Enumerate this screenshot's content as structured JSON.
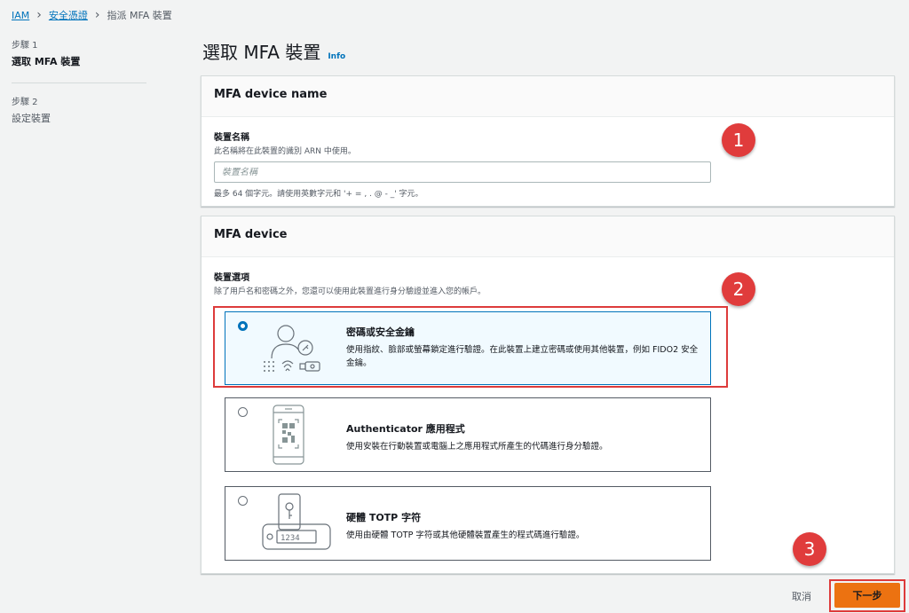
{
  "breadcrumb": {
    "items": [
      "IAM",
      "安全憑證"
    ],
    "current": "指派 MFA 裝置"
  },
  "steps": [
    {
      "label": "步驟 1",
      "title": "選取 MFA 裝置"
    },
    {
      "label": "步驟 2",
      "title": "設定裝置"
    }
  ],
  "page": {
    "title": "選取 MFA 裝置",
    "info": "Info"
  },
  "name_panel": {
    "header": "MFA device name",
    "label": "裝置名稱",
    "description": "此名稱將在此裝置的識別 ARN 中使用。",
    "placeholder": "裝置名稱",
    "constraint": "最多 64 個字元。請使用英數字元和 '+ = , . @ - _' 字元。"
  },
  "device_panel": {
    "header": "MFA device",
    "label": "裝置選項",
    "description": "除了用戶名和密碼之外，您還可以使用此裝置進行身分驗證並進入您的帳戶。",
    "options": [
      {
        "title": "密碼或安全金鑰",
        "description": "使用指紋、臉部或螢幕鎖定進行驗證。在此裝置上建立密碼或使用其他裝置，例如 FIDO2 安全金鑰。",
        "selected": true,
        "icon": "passkey-icon"
      },
      {
        "title": "Authenticator 應用程式",
        "description": "使用安裝在行動裝置或電腦上之應用程式所產生的代碼進行身分驗證。",
        "selected": false,
        "icon": "authenticator-app-icon"
      },
      {
        "title": "硬體 TOTP 字符",
        "description": "使用由硬體 TOTP 字符或其他硬體裝置產生的程式碼進行驗證。",
        "selected": false,
        "icon": "hardware-token-icon",
        "token_display": "1234"
      }
    ]
  },
  "annotations": [
    "1",
    "2",
    "3"
  ],
  "footer": {
    "cancel": "取消",
    "next": "下一步"
  },
  "colors": {
    "accent": "#0073bb",
    "primary_button": "#ec7211",
    "annotation": "#e03c3c"
  }
}
